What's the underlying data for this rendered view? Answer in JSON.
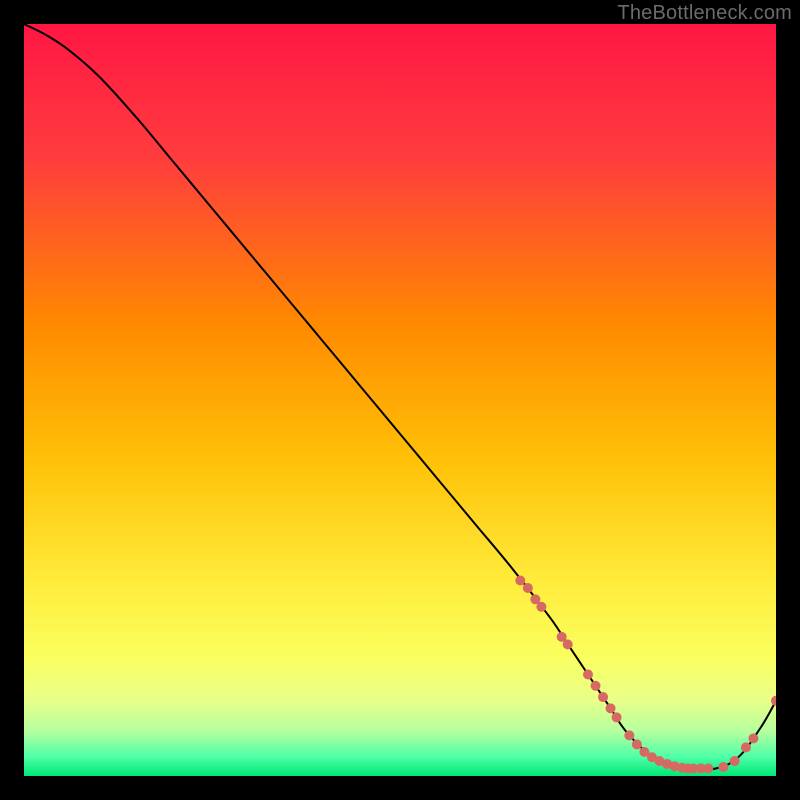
{
  "watermark": "TheBottleneck.com",
  "colors": {
    "bg": "#000000",
    "grad_top": "#ff1744",
    "grad_mid1": "#ff5722",
    "grad_mid2": "#ffc107",
    "grad_mid3": "#ffeb3b",
    "grad_paleyellow": "#ffff8d",
    "grad_green": "#00e676",
    "curve": "#000000",
    "point": "#d66a63"
  },
  "chart_data": {
    "type": "line",
    "title": "",
    "xlabel": "",
    "ylabel": "",
    "xlim": [
      0,
      100
    ],
    "ylim": [
      0,
      100
    ],
    "series": [
      {
        "name": "bottleneck-curve",
        "x": [
          0,
          3,
          6,
          10,
          15,
          20,
          25,
          30,
          35,
          40,
          45,
          50,
          55,
          60,
          65,
          70,
          72,
          75,
          78,
          80,
          83,
          86,
          89,
          92,
          95,
          98,
          100
        ],
        "y": [
          100,
          98.5,
          96.5,
          93,
          87.5,
          81.5,
          75.5,
          69.5,
          63.5,
          57.5,
          51.5,
          45.5,
          39.5,
          33.5,
          27.5,
          21,
          18,
          13.5,
          9,
          6,
          3,
          1.5,
          1,
          1,
          2.5,
          6.5,
          10
        ]
      }
    ],
    "scatter_points": {
      "name": "highlighted-points",
      "x": [
        66,
        67,
        68,
        68.8,
        71.5,
        72.3,
        75,
        76,
        77,
        78,
        78.8,
        80.5,
        81.5,
        82.5,
        83.5,
        84.5,
        85.5,
        86.5,
        87.5,
        88.3,
        89,
        90,
        91,
        93,
        94.5,
        96,
        97,
        100
      ],
      "y": [
        26,
        25,
        23.5,
        22.5,
        18.5,
        17.5,
        13.5,
        12,
        10.5,
        9,
        7.8,
        5.4,
        4.2,
        3.2,
        2.5,
        2,
        1.6,
        1.3,
        1.1,
        1.0,
        1.0,
        1.0,
        1.0,
        1.2,
        2,
        3.8,
        5,
        10
      ]
    },
    "gradient_stops": [
      {
        "offset": 0.0,
        "color": "#ff1744"
      },
      {
        "offset": 0.18,
        "color": "#ff3d3d"
      },
      {
        "offset": 0.4,
        "color": "#ff8a00"
      },
      {
        "offset": 0.58,
        "color": "#ffc107"
      },
      {
        "offset": 0.74,
        "color": "#ffeb3b"
      },
      {
        "offset": 0.84,
        "color": "#faff5e"
      },
      {
        "offset": 0.9,
        "color": "#e8ff8a"
      },
      {
        "offset": 0.94,
        "color": "#b6ff9e"
      },
      {
        "offset": 0.975,
        "color": "#4dffa6"
      },
      {
        "offset": 1.0,
        "color": "#00e676"
      }
    ]
  }
}
